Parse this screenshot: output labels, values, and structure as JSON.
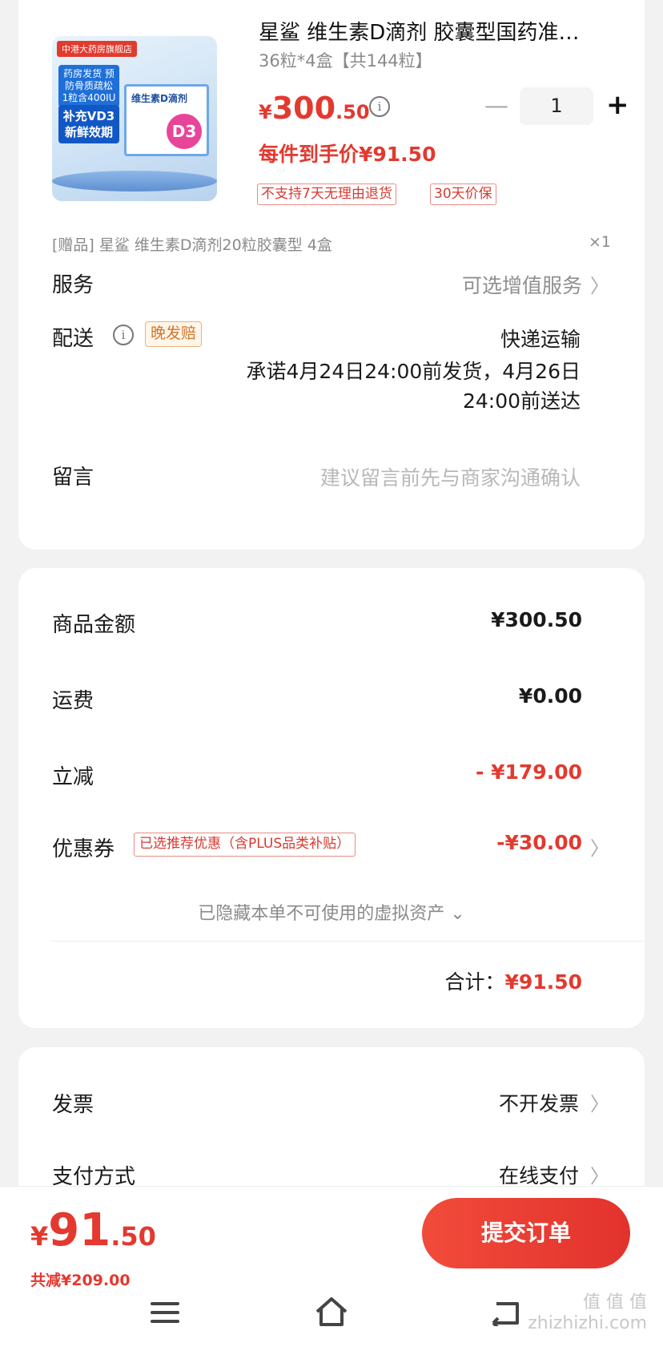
{
  "product": {
    "title": "星鲨 维生素D滴剂 胶囊型国药准…",
    "spec": "36粒*4盒【共144粒】",
    "price_currency": "¥",
    "price_int": "300",
    "price_dec": ".50",
    "quantity": "1",
    "final_price": "每件到手价¥91.50",
    "tags": [
      "不支持7天无理由退货",
      "30天价保"
    ],
    "image": {
      "store": "中港大药房旗舰店",
      "badge1": "药房发货 预防骨质疏松 1粒含400IU",
      "badge2": "补充VD3 新鲜效期",
      "box_title": "维生素D滴剂",
      "box_mark": "D3"
    }
  },
  "gift": {
    "text": "[赠品]   星鲨 维生素D滴剂20粒胶囊型 4盒",
    "qty": "×1"
  },
  "service": {
    "label": "服务",
    "value": "可选增值服务"
  },
  "delivery": {
    "label": "配送",
    "late_tag": "晚发赔",
    "method": "快递运输",
    "promise": "承诺4月24日24:00前发货，4月26日24:00前送达"
  },
  "message": {
    "label": "留言",
    "placeholder": "建议留言前先与商家沟通确认"
  },
  "summary": {
    "amount_label": "商品金额",
    "amount_value": "¥300.50",
    "shipping_label": "运费",
    "shipping_value": "¥0.00",
    "discount_label": "立减",
    "discount_value": "- ¥179.00",
    "coupon_label": "优惠券",
    "coupon_tag": "已选推荐优惠（含PLUS品类补贴）",
    "coupon_value": "-¥30.00",
    "hidden_assets": "已隐藏本单不可使用的虚拟资产 ⌄",
    "total_label": "合计：",
    "total_value": "¥91.50"
  },
  "invoice": {
    "label": "发票",
    "value": "不开发票"
  },
  "payment": {
    "label": "支付方式",
    "value": "在线支付"
  },
  "bottom": {
    "currency": "¥",
    "price_int": "91",
    "price_dec": ".50",
    "saved": "共减¥209.00",
    "submit": "提交订单"
  },
  "watermark": "值 值 值\nzhizhizhi.com",
  "colors": {
    "accent": "#e3392f",
    "background": "#f2f2f2"
  }
}
